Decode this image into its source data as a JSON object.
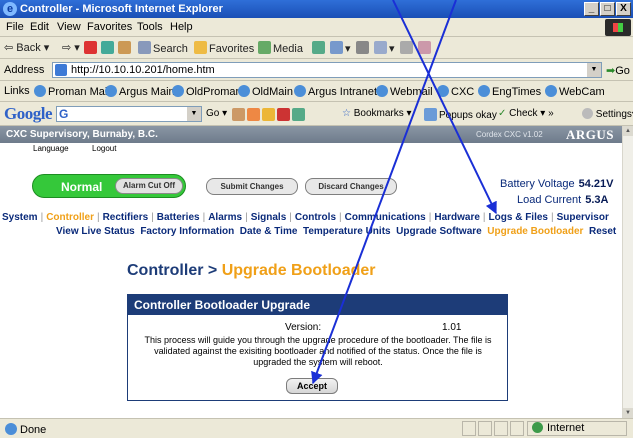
{
  "callout_text": "",
  "window": {
    "title": "Controller - Microsoft Internet Explorer",
    "buttons": [
      "_",
      "□",
      "X"
    ]
  },
  "menubar": [
    "File",
    "Edit",
    "View",
    "Favorites",
    "Tools",
    "Help"
  ],
  "toolbar": {
    "back": "Back",
    "search": "Search",
    "favorites": "Favorites",
    "media": "Media"
  },
  "address": {
    "label": "Address",
    "url": "http://10.10.10.201/home.htm",
    "go": "Go"
  },
  "links": {
    "label": "Links",
    "items": [
      "Proman Main",
      "Argus Main",
      "OldProman",
      "OldMain",
      "Argus Intranet",
      "Webmail",
      "CXC",
      "EngTimes",
      "WebCam"
    ]
  },
  "googlebar": {
    "logo": "Google",
    "search_prefix": "G",
    "go": "Go",
    "bookmarks": "Bookmarks",
    "popups": "Popups okay",
    "check": "Check",
    "more": "»",
    "settings": "Settings"
  },
  "page": {
    "site_title": "CXC Supervisory, Burnaby, B.C.",
    "version": "Cordex CXC v1.02",
    "brand": "ARGUS",
    "sublinks": [
      "Language",
      "Logout"
    ],
    "status": {
      "text": "Normal",
      "alarm_cut_off": "Alarm Cut Off"
    },
    "submit": "Submit Changes",
    "discard": "Discard Changes",
    "battery_voltage_label": "Battery Voltage",
    "battery_voltage": "54.21V",
    "load_current_label": "Load Current",
    "load_current": "5.3A",
    "nav_primary": [
      "System",
      "Controller",
      "Rectifiers",
      "Batteries",
      "Alarms",
      "Signals",
      "Controls",
      "Communications",
      "Hardware",
      "Logs & Files",
      "Supervisor"
    ],
    "nav_secondary": [
      "View Live Status",
      "Factory Information",
      "Date & Time",
      "Temperature Units",
      "Upgrade Software",
      "Upgrade Bootloader",
      "Reset"
    ],
    "heading_prefix": "Controller",
    "heading_sep": ">",
    "heading_highlight": "Upgrade Bootloader",
    "panel": {
      "title": "Controller Bootloader Upgrade",
      "version_label": "Version:",
      "version_value": "1.01",
      "description": "This process will guide you through the upgrade procedure of the bootloader. The file is validated against the exisiting bootloader and notified of the status. Once the file is upgraded the system will reboot.",
      "accept": "Accept"
    }
  },
  "statusbar": {
    "done": "Done",
    "zone": "Internet"
  },
  "colors": {
    "nav_active": "#f0a018",
    "nav_text": "#0a2a7a",
    "panel_header": "#1d3c78",
    "status_ok": "#35c83a",
    "annotation_arrow": "#1a2fd6"
  }
}
